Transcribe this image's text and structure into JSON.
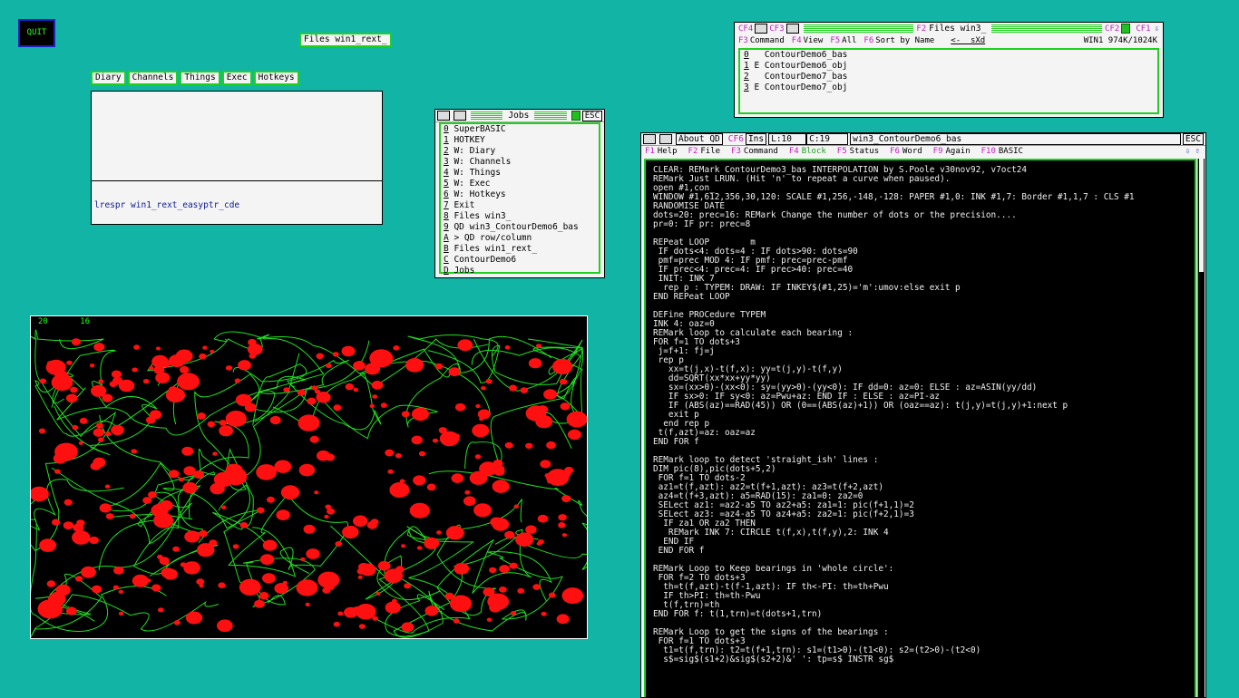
{
  "quit_label": "QUIT",
  "files_label": "Files win1_rext_",
  "menubar": [
    "Diary",
    "Channels",
    "Things",
    "Exec",
    "Hotkeys"
  ],
  "diary_cmd": "lrespr win1_rext_easyptr_cde",
  "jobs": {
    "title": "Jobs",
    "esc": "ESC",
    "items": [
      {
        "k": "0",
        "t": " SuperBASIC"
      },
      {
        "k": "1",
        "t": " HOTKEY"
      },
      {
        "k": "2",
        "t": " W: Diary"
      },
      {
        "k": "3",
        "t": " W: Channels"
      },
      {
        "k": "4",
        "t": " W: Things"
      },
      {
        "k": "5",
        "t": " W: Exec"
      },
      {
        "k": "6",
        "t": " W: Hotkeys"
      },
      {
        "k": "7",
        "t": " Exit"
      },
      {
        "k": "8",
        "t": " Files win3_"
      },
      {
        "k": "9",
        "t": " QD win3_ContourDemo6_bas"
      },
      {
        "k": "A",
        "t": " > QD row/column"
      },
      {
        "k": "B",
        "t": " Files win1_rext_"
      },
      {
        "k": "C",
        "t": " ContourDemo6"
      },
      {
        "k": "D",
        "t": " Jobs"
      }
    ]
  },
  "files_win": {
    "bar1": {
      "cf4": "CF4",
      "cf3": "CF3",
      "f2": "F2",
      "title": "Files win3_",
      "cf2": "CF2",
      "cf1": "CF1"
    },
    "bar2": [
      {
        "k": "F3",
        "t": "Command"
      },
      {
        "k": "F4",
        "t": "View"
      },
      {
        "k": "F5",
        "t": "All"
      },
      {
        "k": "F6",
        "t": "Sort by Name"
      }
    ],
    "nav": "<-  sXd",
    "drive": "WIN1 974K/1024K",
    "items": [
      {
        "k": "0",
        "t": "   ContourDemo6_bas"
      },
      {
        "k": "1",
        "t": " E ContourDemo6_obj"
      },
      {
        "k": "2",
        "t": "   ContourDemo7_bas"
      },
      {
        "k": "3",
        "t": " E ContourDemo7_obj"
      }
    ]
  },
  "graph": {
    "dots": "20",
    "prec": "16"
  },
  "editor": {
    "about": "About QD",
    "cf6": "CF6",
    "ins": "Ins",
    "line": "L:10",
    "col": "C:19",
    "file": "win3_ContourDemo6_bas",
    "esc": "ESC",
    "keys": [
      {
        "k": "F1",
        "t": "Help"
      },
      {
        "k": "F2",
        "t": "File"
      },
      {
        "k": "F3",
        "t": "Command"
      },
      {
        "k": "F4",
        "t": "Block"
      },
      {
        "k": "F5",
        "t": "Status"
      },
      {
        "k": "F6",
        "t": "Word"
      },
      {
        "k": "F9",
        "t": "Again"
      },
      {
        "k": "F10",
        "t": "BASIC"
      }
    ],
    "code": "CLEAR: REMark ContourDemo3_bas INTERPOLATION by S.Poole v30nov92, v7oct24\nREMark Just LRUN. (Hit 'n' to repeat a curve when paused).\nopen #1,con_\nWINDOW #1,612,356,30,120: SCALE #1,256,-148,-128: PAPER #1,0: INK #1,7: Border #1,1,7 : CLS #1\nRANDOMISE DATE\ndots=20: prec=16: REMark Change the number of dots or the precision....\npr=0: IF pr: prec=8\n\nREPeat LOOP        m\n IF dots<4: dots=4 : IF dots>90: dots=90\n pmf=prec MOD 4: IF pmf: prec=prec-pmf\n IF prec<4: prec=4: IF prec>40: prec=40\n INIT: INK 7\n  rep p : TYPEM: DRAW: IF INKEY$(#1,25)='m':umov:else exit p\nEND REPeat LOOP\n\nDEFine PROCedure TYPEM\nINK 4: oaz=0\nREMark loop to calculate each bearing :\nFOR f=1 TO dots+3\n j=f+1: fj=j\n rep p\n   xx=t(j,x)-t(f,x): yy=t(j,y)-t(f,y)\n   dd=SQRT(xx*xx+yy*yy)\n   sx=(xx>0)-(xx<0): sy=(yy>0)-(yy<0): IF dd=0: az=0: ELSE : az=ASIN(yy/dd)\n   IF sx>0: IF sy<0: az=Pwu+az: END IF : ELSE : az=PI-az\n   IF (ABS(az)==RAD(45)) OR (0==(ABS(az)+1)) OR (oaz==az): t(j,y)=t(j,y)+1:next p\n   exit p\n  end rep p\n t(f,azt)=az: oaz=az\nEND FOR f\n\nREMark loop to detect 'straight_ish' lines :\nDIM pic(8),pic(dots+5,2)\n FOR f=1 TO dots-2\n az1=t(f,azt): az2=t(f+1,azt): az3=t(f+2,azt)\n az4=t(f+3,azt): a5=RAD(15): za1=0: za2=0\n SELect az1: =az2-a5 TO az2+a5: za1=1: pic(f+1,1)=2\n SELect az3: =az4-a5 TO az4+a5: za2=1: pic(f+2,1)=3\n  IF za1 OR za2 THEN\n   REMark INK 7: CIRCLE t(f,x),t(f,y),2: INK 4\n  END IF\n END FOR f\n\nREMark Loop to Keep bearings in 'whole circle':\n FOR f=2 TO dots+3\n  th=t(f,azt)-t(f-1,azt): IF th<-PI: th=th+Pwu\n  IF th>PI: th=th-Pwu\n  t(f,trn)=th\nEND FOR f: t(1,trn)=t(dots+1,trn)\n\nREMark Loop to get the signs of the bearings :\n FOR f=1 TO dots+3\n  t1=t(f,trn): t2=t(f+1,trn): s1=(t1>0)-(t1<0): s2=(t2>0)-(t2<0)\n  s$=sig$(s1+2)&sig$(s2+2)&' ': tp=s$ INSTR sg$"
  },
  "colors": {
    "desktop": "#12b4a5",
    "accent": "#20d020",
    "dot": "#ff1010",
    "curve": "#20e020"
  }
}
